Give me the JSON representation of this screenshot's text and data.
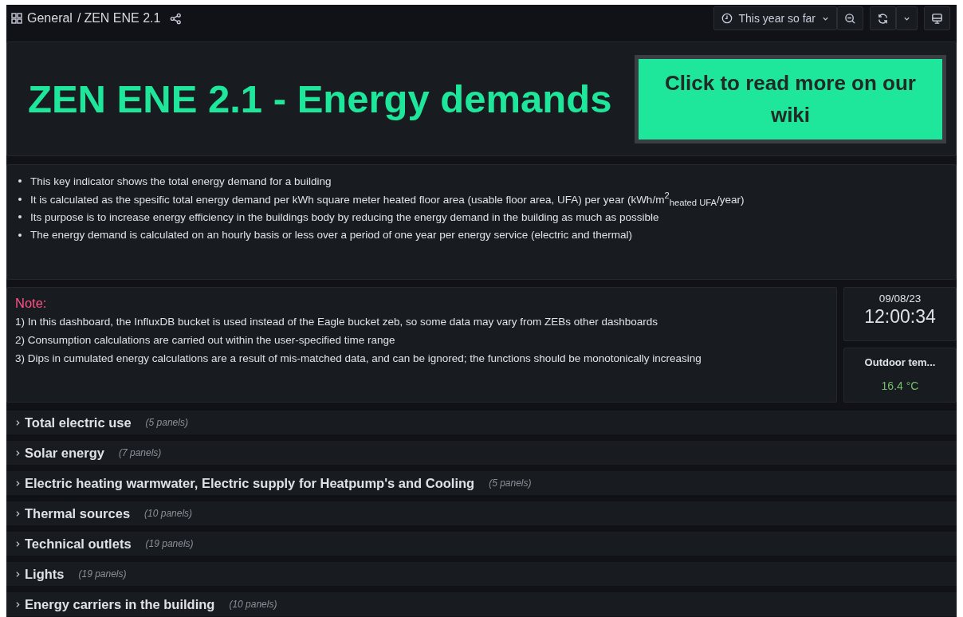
{
  "breadcrumb": {
    "folder": "General",
    "separator": "/",
    "dashboard": "ZEN ENE 2.1"
  },
  "toolbar": {
    "time_range": "This year so far"
  },
  "header": {
    "title": "ZEN ENE 2.1 - Energy demands",
    "wiki_button": "Click to read more on our wiki"
  },
  "description": [
    "This key indicator shows the total energy demand for a building",
    "It is calculated as the spesific total energy demand per kWh square meter heated floor area (usable floor area, UFA) per year (kWh/m$^{2}$$_{heated UFA}$/year)",
    "Its purpose is to increase energy efficiency in the buildings body by reducing the energy demand in the building as much as possible",
    "The energy demand is calculated on an hourly basis or less over a period of one year per energy service (electric and thermal)"
  ],
  "note": {
    "title": "Note:",
    "lines": [
      "1) In this dashboard, the InfluxDB bucket is used instead of the Eagle bucket zeb, so some data may vary from ZEBs other dashboards",
      "2) Consumption calculations are carried out within the user-specified time range",
      "3) Dips in cumulated energy calculations are a result of mis-matched data, and can be ignored; the functions should be monotonically increasing"
    ]
  },
  "clock": {
    "date": "09/08/23",
    "time": "12:00:34"
  },
  "outdoor_temp": {
    "title": "Outdoor tem...",
    "value": "16.4 °C"
  },
  "rows": [
    {
      "title": "Total electric use",
      "count": "(5 panels)",
      "expanded": false
    },
    {
      "title": "Solar energy",
      "count": "(7 panels)",
      "expanded": false
    },
    {
      "title": "Electric heating warmwater, Electric supply for Heatpump's and Cooling",
      "count": "(5 panels)",
      "expanded": false
    },
    {
      "title": "Thermal sources",
      "count": "(10 panels)",
      "expanded": false
    },
    {
      "title": "Technical outlets",
      "count": "(19 panels)",
      "expanded": false
    },
    {
      "title": "Lights",
      "count": "(19 panels)",
      "expanded": false
    },
    {
      "title": "Energy carriers in the building",
      "count": "(10 panels)",
      "expanded": false
    }
  ]
}
